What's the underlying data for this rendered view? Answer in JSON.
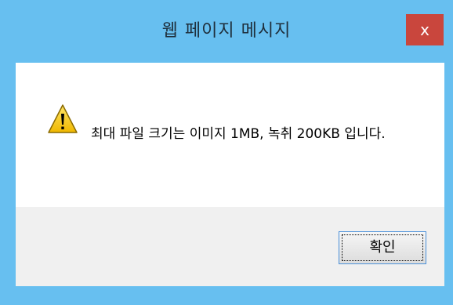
{
  "window": {
    "title": "웹 페이지 메시지",
    "close_label": "x"
  },
  "message": {
    "icon": "warning-icon",
    "text": "최대 파일 크기는 이미지 1MB, 녹취 200KB 입니다."
  },
  "buttons": {
    "ok_label": "확인"
  },
  "colors": {
    "titlebar": "#67bff0",
    "close": "#c9463d",
    "content_bg": "#ffffff",
    "footer_bg": "#f0f0f0",
    "warning_fill": "#f5c400"
  }
}
